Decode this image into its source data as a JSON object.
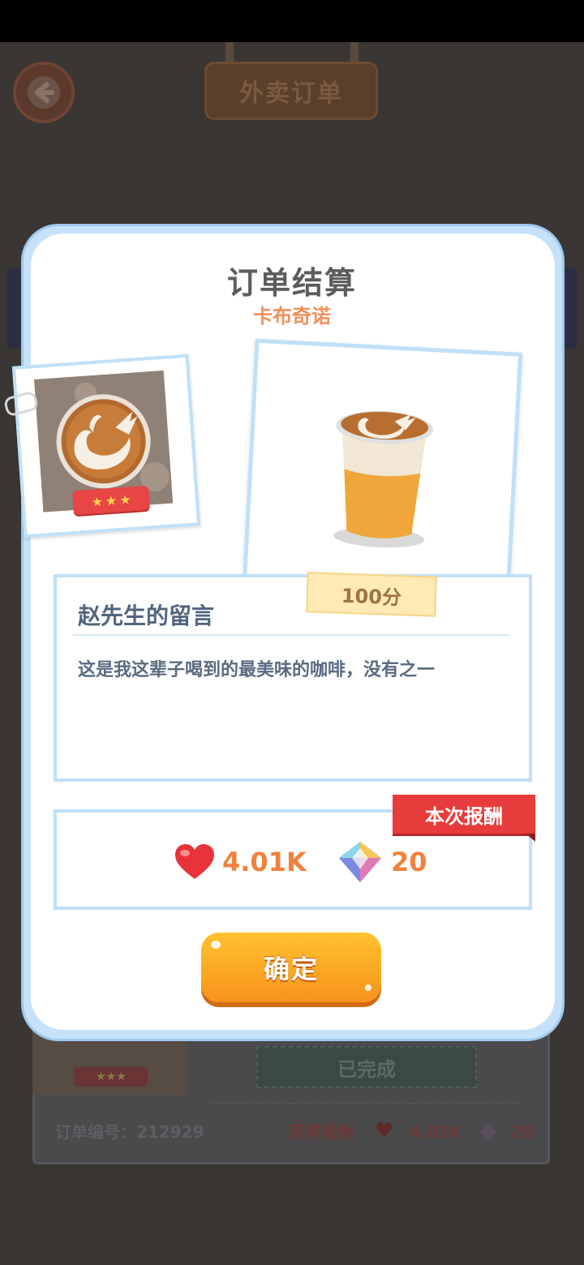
{
  "background": {
    "header_sign": "外卖订单",
    "order_card": {
      "status": "已完成",
      "order_number_label": "订单编号：212929",
      "reward_label": "获得报酬",
      "hearts": "4.01K",
      "gems": "20",
      "rating_stars": 3
    }
  },
  "dialog": {
    "title": "订单结算",
    "product_name": "卡布奇诺",
    "rating_stars": 3,
    "score": "100分",
    "message": {
      "title": "赵先生的留言",
      "text": "这是我这辈子喝到的最美味的咖啡，没有之一"
    },
    "reward": {
      "label": "本次报酬",
      "hearts": "4.01K",
      "gems": "20"
    },
    "confirm_label": "确定"
  },
  "colors": {
    "accent_orange": "#f7931c",
    "reward_red": "#e83b3b",
    "frame_blue": "#bfe0f8",
    "value_orange": "#f1813c"
  }
}
